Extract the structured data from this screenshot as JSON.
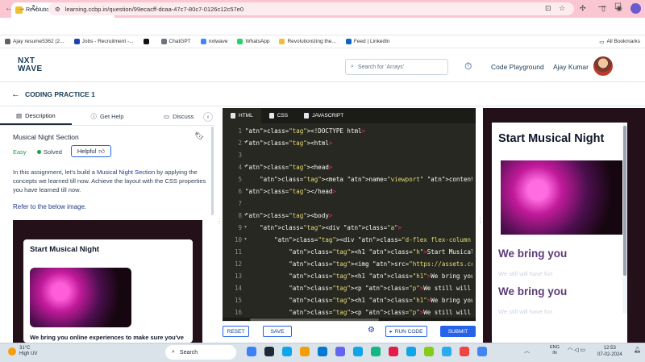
{
  "browser": {
    "tab_title": "Revolutionizing the Job Marke",
    "tab_close": "✕",
    "new_tab": "+",
    "url": "learning.ccbp.in/question/99ecacff-dcaa-47c7-80c7-0126c12c57e0",
    "bookmarks": [
      {
        "label": "Ajay resume5362 (2...",
        "color": "#5f6368"
      },
      {
        "label": "Jobs - Recruitment -...",
        "color": "#1e40af"
      },
      {
        "label": "",
        "color": "#111111"
      },
      {
        "label": "ChatGPT",
        "color": "#6b7280"
      },
      {
        "label": "nxtwave",
        "color": "#4285f4"
      },
      {
        "label": "WhatsApp",
        "color": "#25d366"
      },
      {
        "label": "Revolutionizing the...",
        "color": "#f0bd33"
      },
      {
        "label": "Feed | LinkedIn",
        "color": "#0a66c2"
      }
    ],
    "all_bookmarks": "All Bookmarks"
  },
  "header": {
    "logo_line1": "NXT",
    "logo_line2": "WAVE",
    "search_placeholder": "Search for 'Arrays'",
    "code_playground": "Code Playground",
    "user_name": "Ajay Kumar"
  },
  "subheader": {
    "title": "CODING PRACTICE 1"
  },
  "left_panel": {
    "tabs": [
      {
        "label": "Description",
        "icon": "📄"
      },
      {
        "label": "Get Help",
        "icon": "?"
      },
      {
        "label": "Discuss",
        "icon": "💬"
      }
    ],
    "question_title": "Musical Night Section",
    "difficulty": "Easy",
    "status": "Solved",
    "helpful_label": "Helpful",
    "description_pre": "In this assignment, let's build a ",
    "description_highlight": "Musical Night Section",
    "description_post": " by applying the concepts we learned till now. Achieve the layout with the CSS properties you have learned till now.",
    "refer_text": "Refer to the below image.",
    "preview_heading": "Start Musical Night",
    "preview_subtext": "We bring you online experiences to make sure you've"
  },
  "editor": {
    "tabs": [
      "HTML",
      "CSS",
      "JAVASCRIPT"
    ],
    "line_numbers": [
      "1",
      "2",
      "3",
      "4",
      "5",
      "6",
      "7",
      "8",
      "9",
      "10",
      "11",
      "12",
      "13",
      "14",
      "15",
      "16"
    ],
    "lines": [
      "<!DOCTYPE html>",
      "<html>",
      "",
      "<head>",
      "    <meta name=\"viewport\" content=\"width=device-width, initia",
      "</head>",
      "",
      "<body>",
      "    <div class=\"a\">",
      "        <div class=\"d-flex flex-column b\">",
      "            <h1 class=\"h\">Start Musical Night</h1>",
      "            <img src=\"https://assets.ccbp.in/frontend/interme",
      "            <h1 class=\"h1\">We bring you</h1>",
      "            <p class=\"p\">We still will have fun</p>",
      "            <h1 class=\"h1\">We bring you</h1>",
      "            <p class=\"p\">We still will have fun</p>"
    ],
    "reset": "RESET",
    "save": "SAVE",
    "run_code": "RUN CODE",
    "submit": "SUBMIT"
  },
  "output": {
    "heading": "Start Musical Night",
    "bring1": "We bring you",
    "fun1": "We still will have fun",
    "bring2": "We bring you",
    "fun2": "We still will have fun"
  },
  "taskbar": {
    "temperature": "31°C",
    "weather": "High UV",
    "search": "Search",
    "lang1": "ENG",
    "lang2": "IN",
    "time": "12:53",
    "date": "07-02-2024",
    "app_colors": [
      "#3b82f6",
      "#1f2937",
      "#0ea5e9",
      "#f59e0b",
      "#0078d4",
      "#6366f1",
      "#0ea5e9",
      "#10b981",
      "#e11d48",
      "#0ea5e9",
      "#84cc16",
      "#2aabee",
      "#ef4444",
      "#4285f4"
    ]
  }
}
